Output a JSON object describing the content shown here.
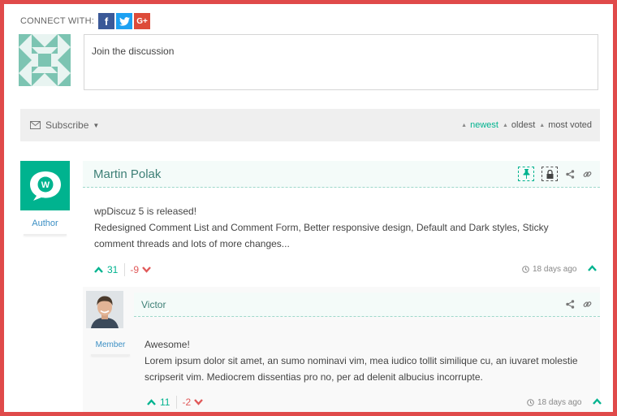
{
  "connect": {
    "label": "CONNECT WITH:",
    "facebook": "f",
    "twitter": "t",
    "google": "G+"
  },
  "form": {
    "placeholder": "Join the discussion"
  },
  "bar": {
    "subscribe": "Subscribe",
    "sort": {
      "newest": "newest",
      "oldest": "oldest",
      "most_voted": "most voted"
    }
  },
  "comments": [
    {
      "author": "Martin Polak",
      "role": "Author",
      "lines": [
        "wpDiscuz 5 is released!",
        "Redesigned Comment List and Comment Form, Better responsive design, Default and Dark styles, Sticky",
        "comment threads and lots of more changes..."
      ],
      "upvotes": "31",
      "downvotes": "-9",
      "time": "18 days ago"
    },
    {
      "author": "Victor",
      "role": "Member",
      "lines": [
        "Awesome!",
        "Lorem ipsum dolor sit amet, an sumo nominavi vim, mea iudico tollit similique cu, an iuvaret molestie",
        "scripserit vim. Mediocrem dissentias pro no, per ad delenit albucius incorrupte."
      ],
      "upvotes": "11",
      "downvotes": "-2",
      "time": "18 days ago"
    }
  ],
  "colors": {
    "accent": "#00b38f",
    "frame": "#e04a4a",
    "role": "#3b8fc4",
    "downvote": "#e05959"
  },
  "icons": [
    "facebook-icon",
    "twitter-icon",
    "google-plus-icon",
    "envelope-icon",
    "pin-icon",
    "lock-icon",
    "share-icon",
    "link-icon",
    "clock-icon",
    "chevron-up-icon",
    "chevron-down-icon"
  ]
}
